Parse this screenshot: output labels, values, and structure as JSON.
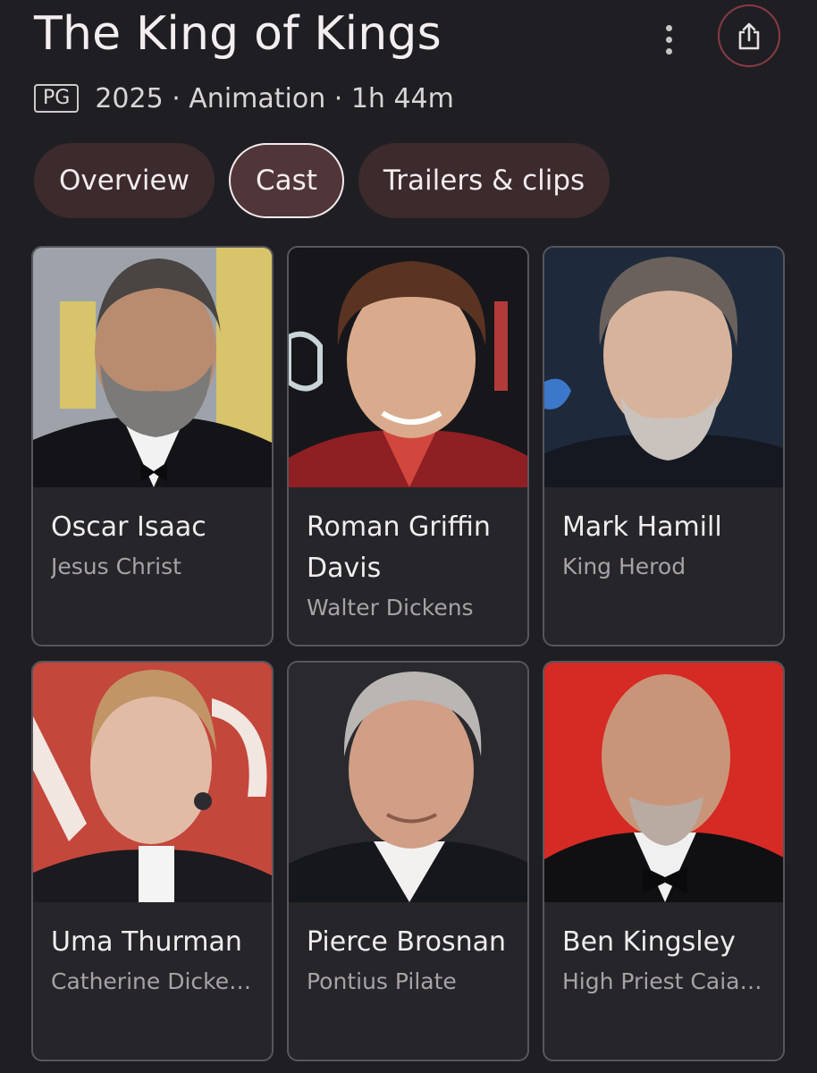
{
  "header": {
    "title": "The King of Kings",
    "rating": "PG",
    "meta": "2025 · Animation · 1h 44m"
  },
  "tabs": [
    {
      "label": "Overview",
      "active": false
    },
    {
      "label": "Cast",
      "active": true
    },
    {
      "label": "Trailers & clips",
      "active": false
    }
  ],
  "cast": [
    {
      "name": "Oscar Isaac",
      "role": "Jesus Christ"
    },
    {
      "name": "Roman Griffin Davis",
      "role": "Walter Dickens"
    },
    {
      "name": "Mark Hamill",
      "role": "King Herod"
    },
    {
      "name": "Uma Thurman",
      "role": "Catherine Dickens"
    },
    {
      "name": "Pierce Brosnan",
      "role": "Pontius Pilate"
    },
    {
      "name": "Ben Kingsley",
      "role": "High Priest Caia…"
    }
  ],
  "icons": {
    "more": "more-vert-icon",
    "share": "share-icon"
  },
  "colors": {
    "background": "#1f1f23",
    "tab": "#3c2a2d",
    "tab_active": "#513639",
    "share_ring": "#8a3a45"
  }
}
